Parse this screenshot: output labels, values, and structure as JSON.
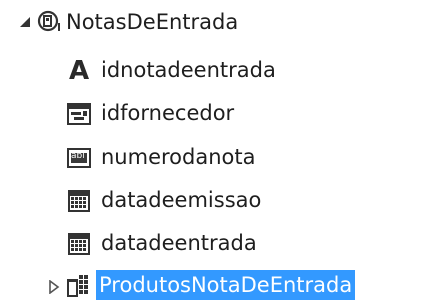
{
  "tree": {
    "root": {
      "label": "NotasDeEntrada",
      "expanded": true,
      "icon": "entity-icon"
    },
    "children": [
      {
        "label": "idnotadeentrada",
        "icon": "text-type-icon"
      },
      {
        "label": "idfornecedor",
        "icon": "lookup-field-icon"
      },
      {
        "label": "numerodanota",
        "icon": "abl-field-icon"
      },
      {
        "label": "datadeemissao",
        "icon": "calendar-icon"
      },
      {
        "label": "datadeentrada",
        "icon": "calendar-icon"
      },
      {
        "label": "ProdutosNotaDeEntrada",
        "icon": "table-relation-icon",
        "expanded": false,
        "selected": true
      }
    ],
    "abl_text": "abl",
    "letter_a": "A",
    "colors": {
      "selection": "#3399ff",
      "text": "#1e1e1e"
    }
  }
}
